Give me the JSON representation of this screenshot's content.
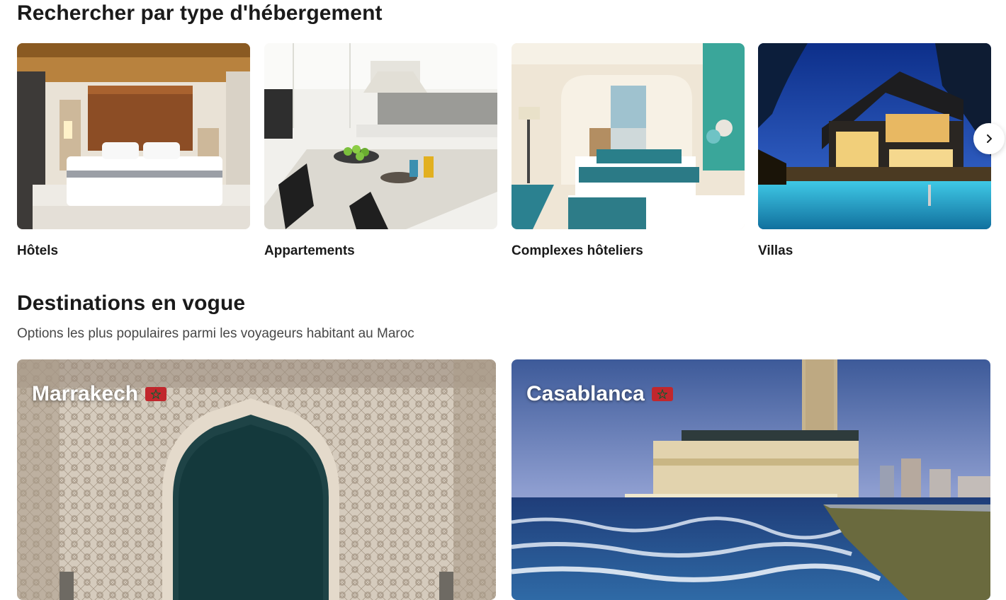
{
  "accommodation_section": {
    "title": "Rechercher par type d'hébergement",
    "types": [
      {
        "label": "Hôtels"
      },
      {
        "label": "Appartements"
      },
      {
        "label": "Complexes hôteliers"
      },
      {
        "label": "Villas"
      }
    ],
    "next_icon": "chevron-right-icon"
  },
  "trending_section": {
    "title": "Destinations en vogue",
    "subtitle": "Options les plus populaires parmi les voyageurs habitant au Maroc",
    "destinations": [
      {
        "name": "Marrakech",
        "flag_icon": "morocco-flag-icon"
      },
      {
        "name": "Casablanca",
        "flag_icon": "morocco-flag-icon"
      }
    ]
  },
  "colors": {
    "flag_red": "#c1272d",
    "flag_green": "#006233",
    "text": "#1a1a1a",
    "subtitle": "#474747"
  }
}
